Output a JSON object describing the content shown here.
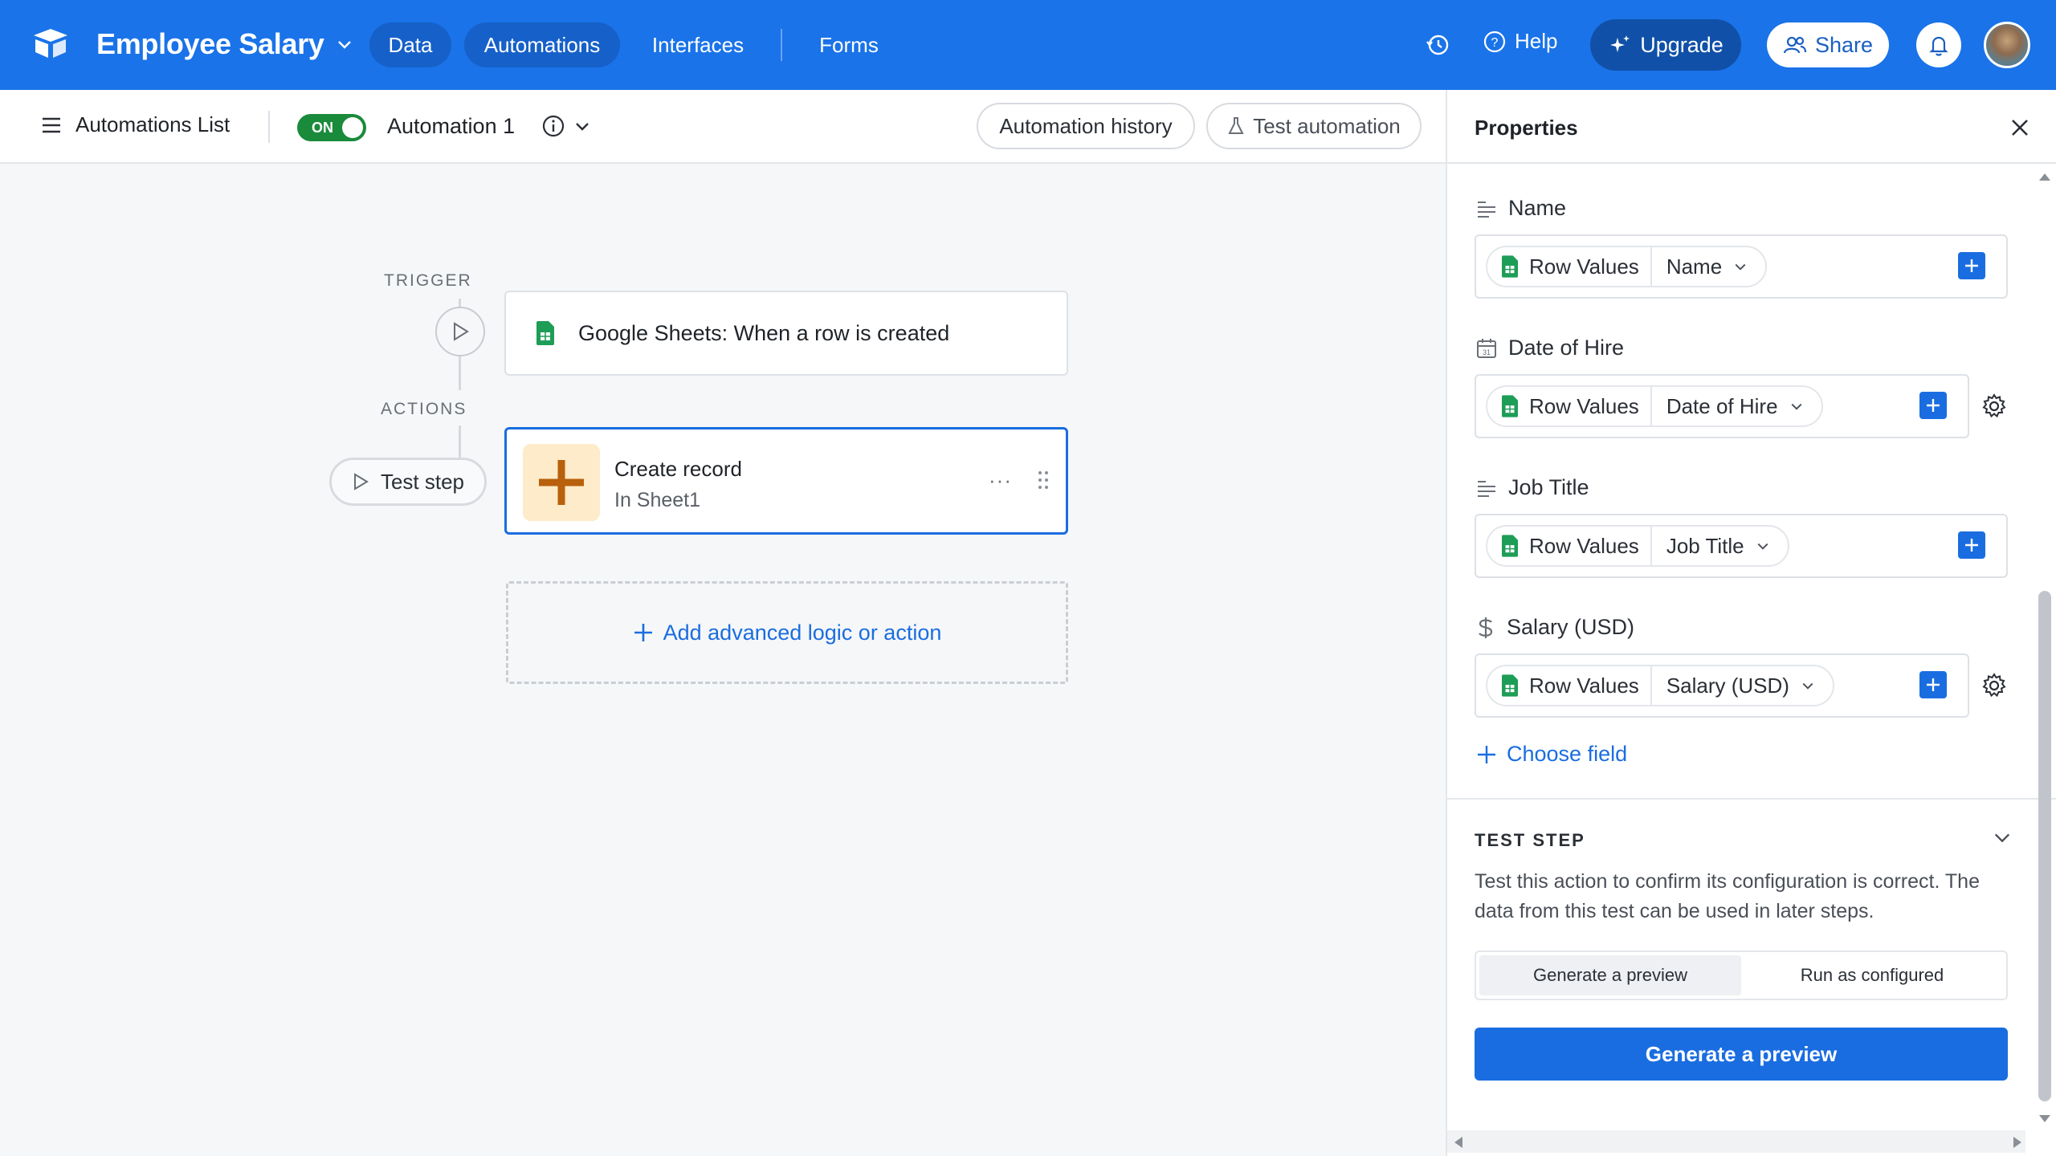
{
  "app": {
    "base_name": "Employee Salary",
    "nav": [
      "Data",
      "Automations",
      "Interfaces",
      "Forms"
    ],
    "help_label": "Help",
    "upgrade_label": "Upgrade",
    "share_label": "Share",
    "brand_color": "#1a73e8"
  },
  "subbar": {
    "automations_list_label": "Automations List",
    "toggle_label": "ON",
    "automation_name": "Automation 1",
    "history_label": "Automation history",
    "test_label": "Test automation"
  },
  "canvas": {
    "trigger_label": "TRIGGER",
    "actions_label": "ACTIONS",
    "trigger_text": "Google Sheets: When a row is created",
    "action_title": "Create record",
    "action_subtitle": "In Sheet1",
    "test_step_label": "Test step",
    "add_logic_label": "Add advanced logic or action"
  },
  "properties": {
    "title": "Properties",
    "fields": [
      {
        "label": "Name",
        "source": "Row Values",
        "value": "Name",
        "icon": "text-lines-icon"
      },
      {
        "label": "Date of Hire",
        "source": "Row Values",
        "value": "Date of Hire",
        "icon": "calendar-icon"
      },
      {
        "label": "Job Title",
        "source": "Row Values",
        "value": "Job Title",
        "icon": "text-lines-icon"
      },
      {
        "label": "Salary (USD)",
        "source": "Row Values",
        "value": "Salary (USD)",
        "icon": "dollar-icon"
      }
    ],
    "choose_field_label": "Choose field",
    "test_step": {
      "heading": "TEST STEP",
      "description": "Test this action to confirm its configuration is correct. The data from this test can be used in later steps.",
      "modes": [
        "Generate a preview",
        "Run as configured"
      ],
      "active_mode": "Generate a preview",
      "primary_button": "Generate a preview"
    }
  }
}
